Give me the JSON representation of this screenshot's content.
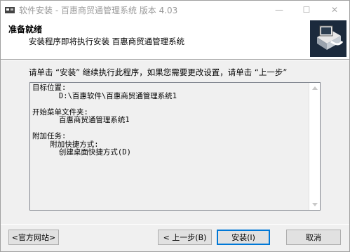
{
  "window": {
    "title": "软件安装 - 百惠商贸通管理系统 版本 4.03",
    "icon": "installer-icon",
    "controls": {
      "minimize": "—",
      "maximize": "☐",
      "close": "✕"
    }
  },
  "header": {
    "title": "准备就绪",
    "subtitle": "安装程序即将执行安装 百惠商贸通管理系统",
    "logo_icon": "computer-install-icon"
  },
  "instruction": "请单击 “安装” 继续执行此程序，如果您需要更改设置，请单击 “上一步”",
  "summary": {
    "text": "目标位置:\n      D:\\百惠软件\\百惠商贸通管理系统1\n\n开始菜单文件夹:\n      百惠商贸通管理系统1\n\n附加任务:\n    附加快捷方式:\n      创建桌面快捷方式(D)"
  },
  "buttons": {
    "website": "<官方网站>",
    "back": "< 上一步(B)",
    "install": "安装(I)",
    "cancel": "取消"
  },
  "colors": {
    "accent": "#0078d7",
    "title_inactive": "#999999"
  }
}
